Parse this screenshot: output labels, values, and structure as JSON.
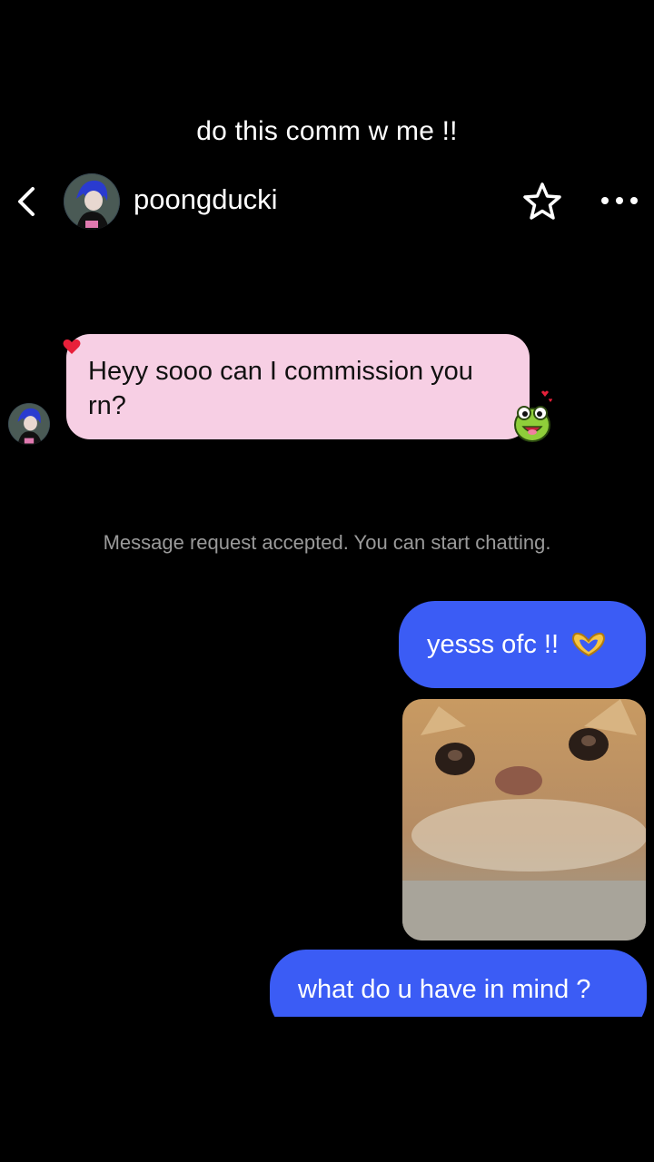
{
  "caption": "do this comm w me !!",
  "header": {
    "username": "poongducki",
    "back_icon": "chevron-left-icon",
    "star_icon": "star-outline-icon",
    "more_icon": "more-horizontal-icon"
  },
  "messages": {
    "incoming": {
      "text": "Heyy sooo can I commission you rn?",
      "bubble_color": "#f7cfe4"
    },
    "system": "Message request accepted. You can start chatting.",
    "outgoing": [
      {
        "text": "yesss ofc !!",
        "emoji": "heart-hands-emoji"
      },
      {
        "text": "what do u have in mind ?"
      }
    ],
    "outgoing_color": "#3b5cf5"
  },
  "stickers": {
    "heart": "heart-icon",
    "frog": "frog-sticker",
    "cat": "cat-image"
  }
}
